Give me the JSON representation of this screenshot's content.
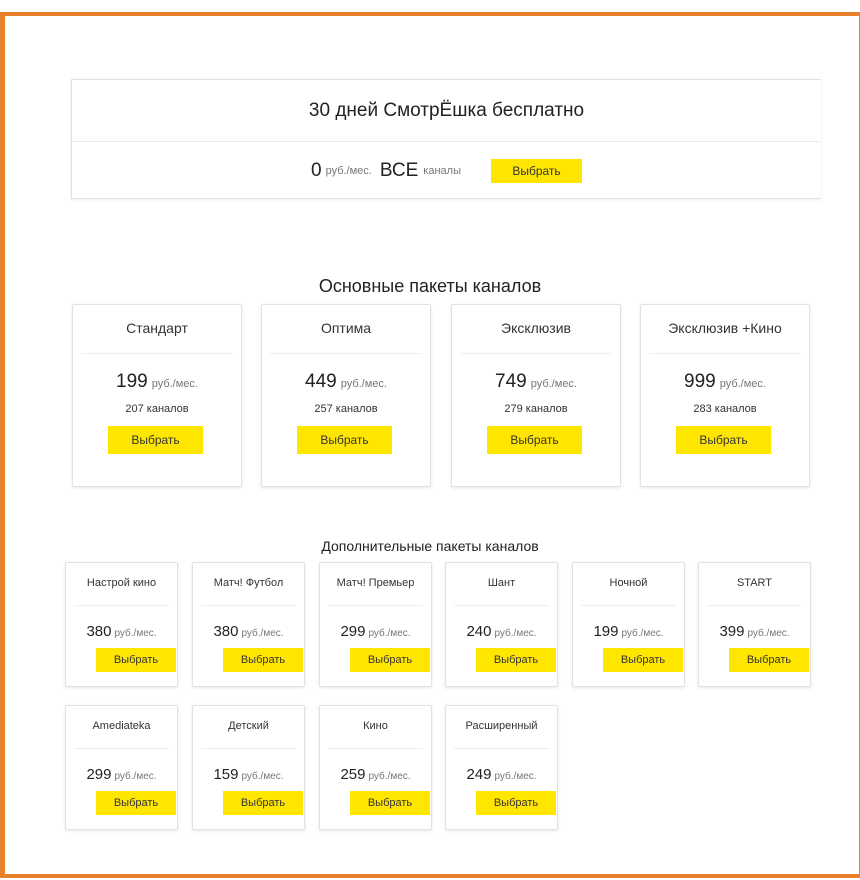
{
  "trial": {
    "title": "30 дней СмотрЁшка бесплатно",
    "price": "0",
    "unit": "руб./мес.",
    "all": "ВСЕ",
    "channels_label": "каналы",
    "button": "Выбрать"
  },
  "main_section_title": "Основные пакеты каналов",
  "main_packages": [
    {
      "name": "Стандарт",
      "price": "199",
      "unit": "руб./мес.",
      "channels": "207 каналов",
      "button": "Выбрать"
    },
    {
      "name": "Оптима",
      "price": "449",
      "unit": "руб./мес.",
      "channels": "257 каналов",
      "button": "Выбрать"
    },
    {
      "name": "Эксклюзив",
      "price": "749",
      "unit": "руб./мес.",
      "channels": "279 каналов",
      "button": "Выбрать"
    },
    {
      "name": "Эксклюзив +Кино",
      "price": "999",
      "unit": "руб./мес.",
      "channels": "283 каналов",
      "button": "Выбрать"
    }
  ],
  "extra_section_title": "Дополнительные пакеты каналов",
  "extra_packages": [
    {
      "name": "Настрой кино",
      "price": "380",
      "unit": "руб./мес.",
      "button": "Выбрать"
    },
    {
      "name": "Матч! Футбол",
      "price": "380",
      "unit": "руб./мес.",
      "button": "Выбрать"
    },
    {
      "name": "Матч! Премьер",
      "price": "299",
      "unit": "руб./мес.",
      "button": "Выбрать"
    },
    {
      "name": "Шант",
      "price": "240",
      "unit": "руб./мес.",
      "button": "Выбрать"
    },
    {
      "name": "Ночной",
      "price": "199",
      "unit": "руб./мес.",
      "button": "Выбрать"
    },
    {
      "name": "START",
      "price": "399",
      "unit": "руб./мес.",
      "button": "Выбрать"
    },
    {
      "name": "Amediateka",
      "price": "299",
      "unit": "руб./мес.",
      "button": "Выбрать"
    },
    {
      "name": "Детский",
      "price": "159",
      "unit": "руб./мес.",
      "button": "Выбрать"
    },
    {
      "name": "Кино",
      "price": "259",
      "unit": "руб./мес.",
      "button": "Выбрать"
    },
    {
      "name": "Расширенный",
      "price": "249",
      "unit": "руб./мес.",
      "button": "Выбрать"
    }
  ],
  "colors": {
    "frame": "#e8822a",
    "button": "#ffe600"
  }
}
